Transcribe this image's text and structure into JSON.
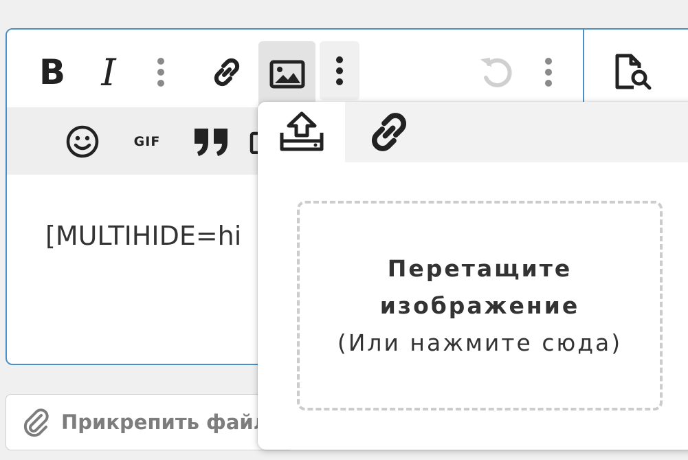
{
  "editor": {
    "text": "[MULTIHIDE=hi"
  },
  "toolbar": {
    "bold_label": "B",
    "italic_label": "I",
    "gif_label": "GIF"
  },
  "attach": {
    "label": "Прикрепить файл"
  },
  "image_popup": {
    "tabs": [
      {
        "icon": "upload-icon",
        "selected": true
      },
      {
        "icon": "link-icon",
        "selected": false
      }
    ],
    "dropzone_title": "Перетащите изображение",
    "dropzone_hint": "(Или нажмите сюда)"
  },
  "colors": {
    "accent_border": "#4a90c6",
    "icon_dark": "#222222",
    "icon_muted": "#8a8a8a"
  }
}
